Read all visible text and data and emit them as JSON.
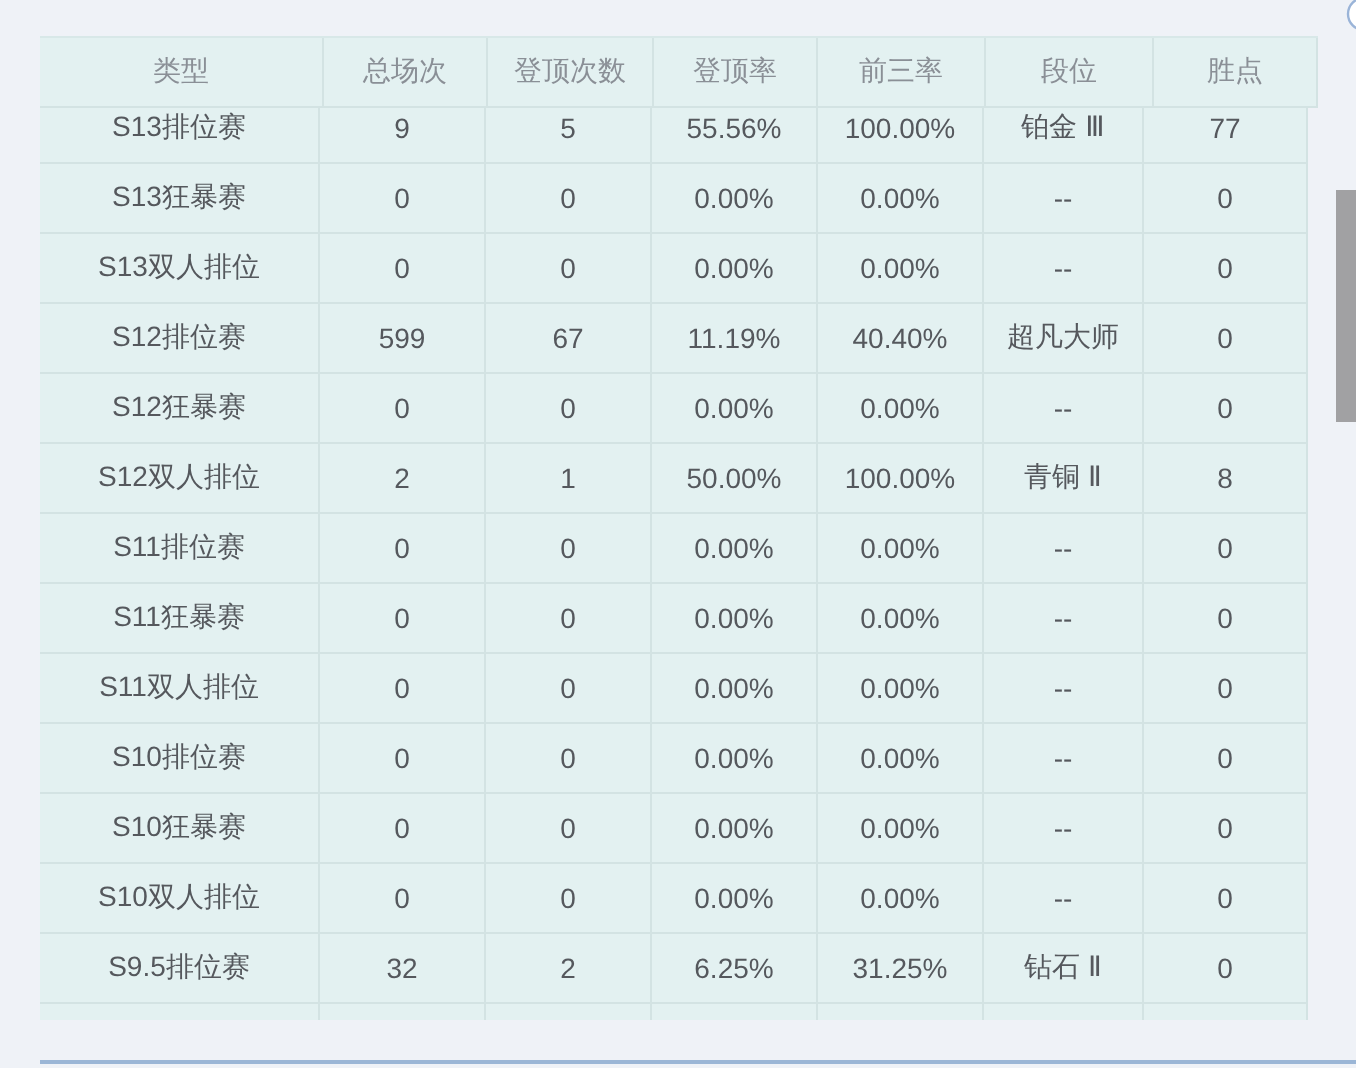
{
  "table": {
    "columns": [
      "类型",
      "总场次",
      "登顶次数",
      "登顶率",
      "前三率",
      "段位",
      "胜点"
    ],
    "rows": [
      [
        "S13排位赛",
        "9",
        "5",
        "55.56%",
        "100.00%",
        "铂金 Ⅲ",
        "77"
      ],
      [
        "S13狂暴赛",
        "0",
        "0",
        "0.00%",
        "0.00%",
        "--",
        "0"
      ],
      [
        "S13双人排位",
        "0",
        "0",
        "0.00%",
        "0.00%",
        "--",
        "0"
      ],
      [
        "S12排位赛",
        "599",
        "67",
        "11.19%",
        "40.40%",
        "超凡大师",
        "0"
      ],
      [
        "S12狂暴赛",
        "0",
        "0",
        "0.00%",
        "0.00%",
        "--",
        "0"
      ],
      [
        "S12双人排位",
        "2",
        "1",
        "50.00%",
        "100.00%",
        "青铜 Ⅱ",
        "8"
      ],
      [
        "S11排位赛",
        "0",
        "0",
        "0.00%",
        "0.00%",
        "--",
        "0"
      ],
      [
        "S11狂暴赛",
        "0",
        "0",
        "0.00%",
        "0.00%",
        "--",
        "0"
      ],
      [
        "S11双人排位",
        "0",
        "0",
        "0.00%",
        "0.00%",
        "--",
        "0"
      ],
      [
        "S10排位赛",
        "0",
        "0",
        "0.00%",
        "0.00%",
        "--",
        "0"
      ],
      [
        "S10狂暴赛",
        "0",
        "0",
        "0.00%",
        "0.00%",
        "--",
        "0"
      ],
      [
        "S10双人排位",
        "0",
        "0",
        "0.00%",
        "0.00%",
        "--",
        "0"
      ],
      [
        "S9.5排位赛",
        "32",
        "2",
        "6.25%",
        "31.25%",
        "钻石 Ⅱ",
        "0"
      ]
    ]
  }
}
